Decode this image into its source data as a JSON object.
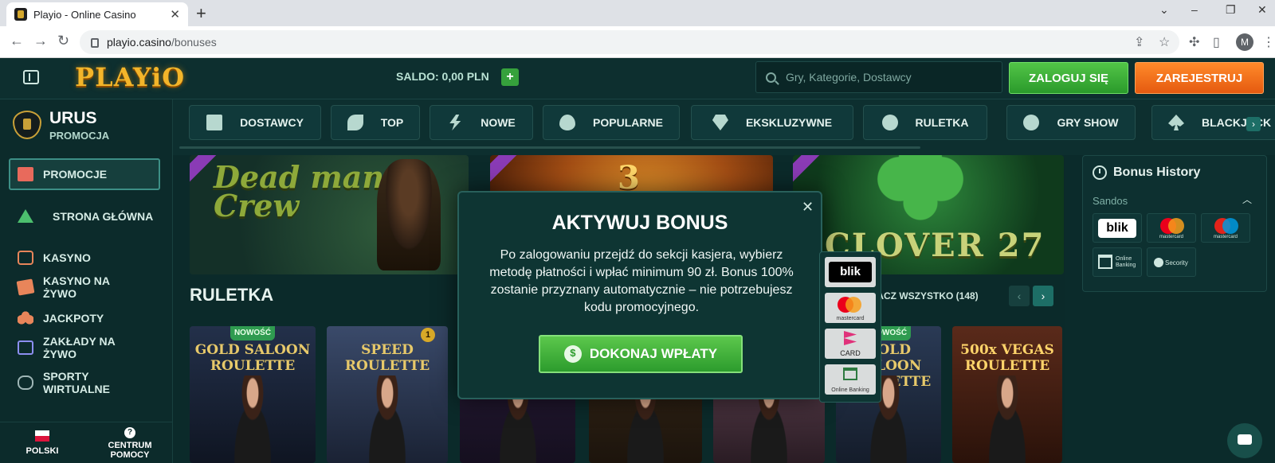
{
  "browser": {
    "tab_title": "Playio - Online Casino",
    "tab_close": "✕",
    "new_tab": "+",
    "url_host": "playio.casino",
    "url_path": "/bonuses",
    "profile_initial": "M"
  },
  "header": {
    "logo": "PLAYiO",
    "saldo": "SALDO: 0,00 PLN",
    "saldo_plus": "+",
    "search_placeholder": "Gry, Kategorie, Dostawcy",
    "login_label": "ZALOGUJ SIĘ",
    "register_label": "ZAREJESTRUJ"
  },
  "sidebar": {
    "brand_name": "URUS",
    "brand_sub": "PROMOCJA",
    "items": [
      {
        "label": "PROMOCJE"
      },
      {
        "label": "STRONA GŁÓWNA"
      },
      {
        "label": "KASYNO"
      },
      {
        "label": "KASYNO NA ŻYWO"
      },
      {
        "label": "JACKPOTY"
      },
      {
        "label": "ZAKŁADY NA ŻYWO"
      },
      {
        "label": "SPORTY WIRTUALNE"
      }
    ],
    "footer": {
      "language": "POLSKI",
      "help": "CENTRUM POMOCY",
      "help_icon": "?"
    }
  },
  "categories": [
    {
      "label": "DOSTAWCY",
      "icon": "document-icon"
    },
    {
      "label": "TOP",
      "icon": "leaf-icon"
    },
    {
      "label": "NOWE",
      "icon": "bolt-icon"
    },
    {
      "label": "POPULARNE",
      "icon": "fire-icon"
    },
    {
      "label": "EKSKLUZYWNE",
      "icon": "diamond-icon"
    },
    {
      "label": "RULETKA",
      "icon": "roulette-icon"
    },
    {
      "label": "GRY SHOW",
      "icon": "wheel-icon"
    },
    {
      "label": "BLACKJACK",
      "icon": "spade-icon"
    }
  ],
  "category_next": "›",
  "banners": [
    {
      "title": "Dead mans Crew"
    },
    {
      "title": "3"
    },
    {
      "title": "CLOVER 27"
    }
  ],
  "section": {
    "title": "RULETKA",
    "see_all": "ZOBACZ WSZYSTKO (148)",
    "prev": "‹",
    "next": "›"
  },
  "games": [
    {
      "title": "GOLD SALOON ROULETTE",
      "badge": "NOWOŚĆ"
    },
    {
      "title": "SPEED ROULETTE",
      "badge": "",
      "number": "1"
    },
    {
      "title": "",
      "badge": ""
    },
    {
      "title": "",
      "badge": ""
    },
    {
      "title": "",
      "badge": ""
    },
    {
      "title": "GOLD SALOON ROULETTE",
      "badge": "NOWOŚĆ"
    },
    {
      "title": "500x VEGAS ROULETTE",
      "badge": ""
    }
  ],
  "bonus_history": {
    "title": "Bonus History",
    "group": "Sandos",
    "methods": [
      {
        "label": "blik"
      },
      {
        "label": "mastercard"
      },
      {
        "label": "mastercard"
      },
      {
        "label": "Online Banking"
      },
      {
        "label": "Secority"
      }
    ]
  },
  "modal": {
    "title": "AKTYWUJ BONUS",
    "text": "Po zalogowaniu przejdź do sekcji kasjera, wybierz metodę płatności i wpłać minimum 90 zł. Bonus 100% zostanie przyznany automatycznie – nie potrzebujesz kodu promocyjnego.",
    "button": "DOKONAJ WPŁATY",
    "close": "✕"
  },
  "modal_payments": [
    {
      "label": "blik"
    },
    {
      "label": "mastercard"
    },
    {
      "label": "CARD"
    },
    {
      "label": "Online Banking"
    }
  ]
}
